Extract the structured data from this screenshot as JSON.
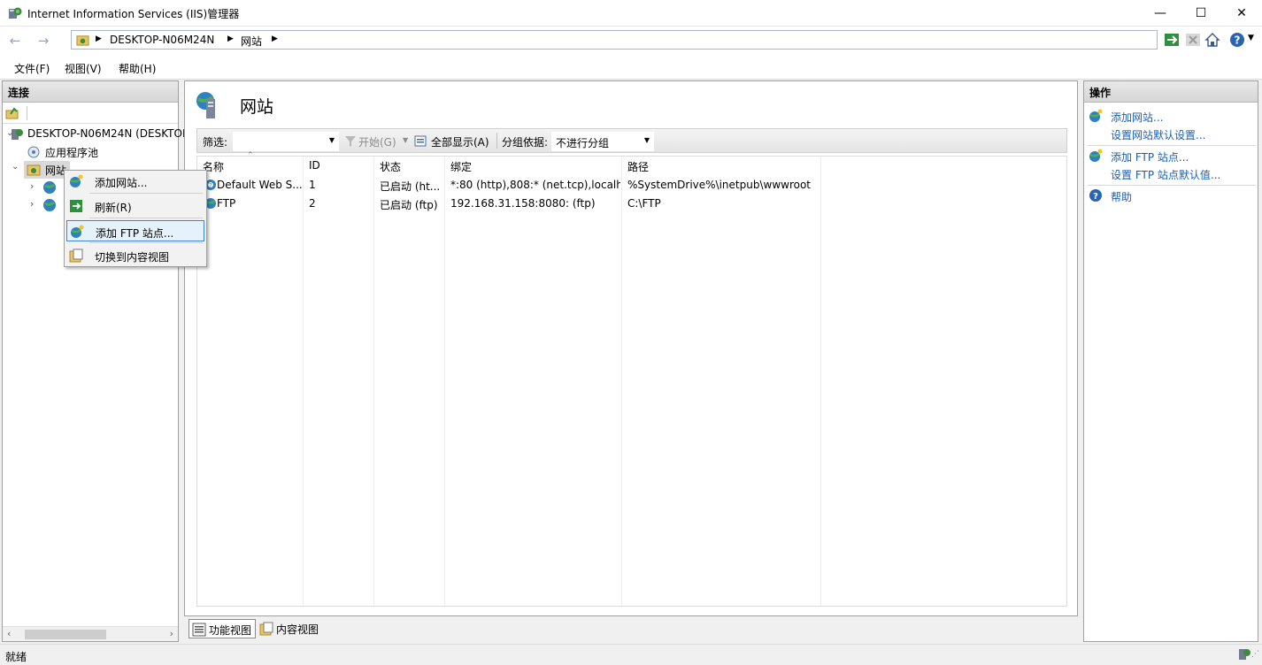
{
  "window": {
    "title": "Internet Information Services (IIS)管理器"
  },
  "address": {
    "crumbs": [
      "DESKTOP-N06M24N",
      "网站"
    ]
  },
  "menu": [
    "文件(F)",
    "视图(V)",
    "帮助(H)"
  ],
  "connections": {
    "header": "连接",
    "tree": [
      {
        "label": "DESKTOP-N06M24N (DESKTOP"
      },
      {
        "label": "应用程序池"
      },
      {
        "label": "网站"
      }
    ]
  },
  "context_menu": {
    "items": [
      "添加网站...",
      "刷新(R)",
      "添加 FTP 站点...",
      "切换到内容视图"
    ],
    "highlighted_index": 2
  },
  "center": {
    "title": "网站",
    "filter_label": "筛选:",
    "filter_value": "",
    "start_label": "开始(G)",
    "show_all_label": "全部显示(A)",
    "group_label": "分组依据:",
    "group_value": "不进行分组",
    "columns": [
      "名称",
      "ID",
      "状态",
      "绑定",
      "路径"
    ],
    "rows": [
      {
        "name": "Default Web S...",
        "id": "1",
        "status": "已启动 (ht...",
        "binding": "*:80 (http),808:* (net.tcp),localh...",
        "path": "%SystemDrive%\\inetpub\\wwwroot"
      },
      {
        "name": "FTP",
        "id": "2",
        "status": "已启动 (ftp)",
        "binding": "192.168.31.158:8080: (ftp)",
        "path": "C:\\FTP"
      }
    ],
    "tabs": [
      "功能视图",
      "内容视图"
    ]
  },
  "actions": {
    "header": "操作",
    "items": [
      "添加网站...",
      "设置网站默认设置...",
      "添加 FTP 站点...",
      "设置 FTP 站点默认值...",
      "帮助"
    ]
  },
  "status": {
    "text": "就绪"
  },
  "colors": {
    "link": "#1a5fb4",
    "highlight_border": "#3f83d6",
    "highlight_fill": "#e5f1fb"
  }
}
